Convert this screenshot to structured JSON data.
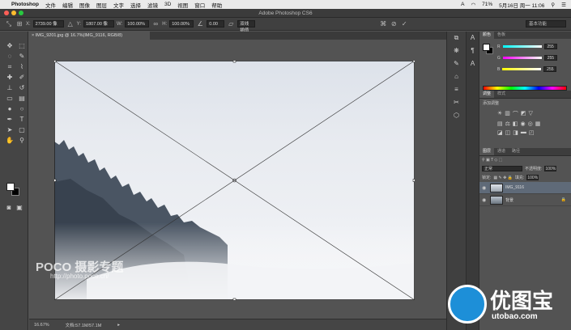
{
  "menubar": {
    "app_name": "Photoshop",
    "menus": [
      "文件",
      "编辑",
      "图像",
      "图层",
      "文字",
      "选择",
      "滤镜",
      "3D",
      "视图",
      "窗口",
      "帮助"
    ],
    "battery": "71%",
    "datetime": "5月16日 周一 11:06"
  },
  "window": {
    "title": "Adobe Photoshop CS6"
  },
  "options": {
    "x_label": "X:",
    "x_value": "2739.00 像",
    "y_label": "Y:",
    "y_value": "1807.00 像",
    "w_label": "W:",
    "w_value": "100.00%",
    "h_label": "H:",
    "h_value": "100.00%",
    "angle_value": "0.00",
    "interp": "双线插值",
    "workspace": "基本功能"
  },
  "document": {
    "tab_label": "IMG_9201.jpg @ 16.7%(IMG_9116, RGB/8)",
    "zoom": "16.67%",
    "doc_size": "文档:57.1M/57.1M"
  },
  "panels": {
    "color_tabs": [
      "颜色",
      "色板"
    ],
    "r_label": "R",
    "r_value": "255",
    "g_label": "G",
    "g_value": "255",
    "b_label": "B",
    "b_value": "255",
    "adjust_tabs": [
      "调整",
      "样式"
    ],
    "adjust_title": "添加调整",
    "layer_tabs": [
      "图层",
      "通道",
      "路径"
    ],
    "blend_mode": "正常",
    "opacity_label": "不透明度:",
    "opacity_value": "100%",
    "lock_label": "锁定:",
    "fill_label": "填充:",
    "fill_value": "100%",
    "layers": [
      {
        "name": "IMG_9116",
        "selected": true
      },
      {
        "name": "背景",
        "selected": false
      }
    ]
  },
  "watermark": {
    "left_text": "POCO 摄影专题",
    "left_url": "http://photo.poco.cn/",
    "right_cn": "优图宝",
    "right_url": "utobao.com"
  },
  "colors": {
    "accent": "#5f6a78",
    "light_red": "#ff5f57",
    "light_yellow": "#febc2e",
    "light_green": "#28c840"
  }
}
